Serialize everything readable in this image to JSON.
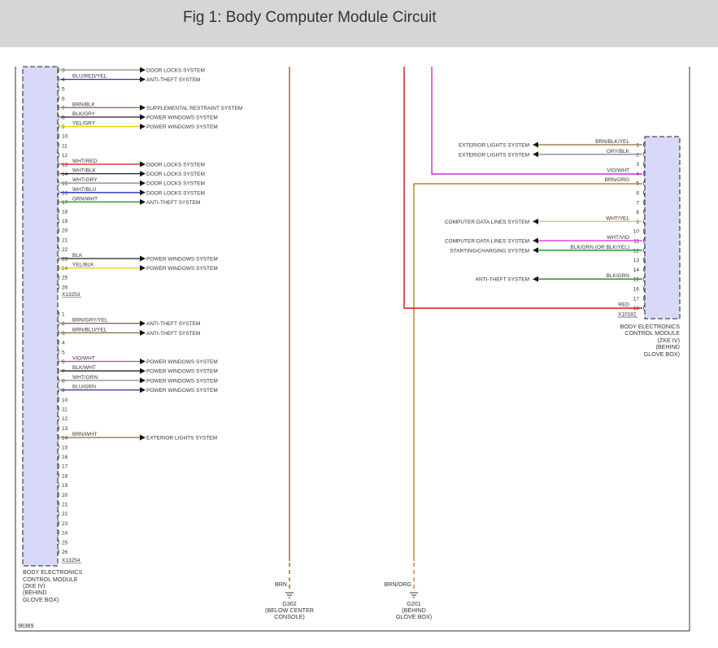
{
  "header": {
    "title": "Fig 1: Body Computer Module Circuit"
  },
  "colors": {
    "module_fill": "#d8d8f8",
    "WHT": "#d0d0d0",
    "BLU": "#2a2ab8",
    "BRN": "#8b6a2b",
    "GRY": "#8a8a8a",
    "YEL": "#e0d000",
    "RED": "#e01010",
    "GRN": "#1a8a1a",
    "BLK": "#202020",
    "VIO": "#e020e0",
    "ORG": "#b8862a"
  },
  "connector_a": {
    "label": "X13253",
    "first_pin": 3,
    "last_pin": 26,
    "wires": [
      {
        "pin": 3,
        "color": "",
        "system": "DOOR LOCKS SYSTEM",
        "stroke": "GRY"
      },
      {
        "pin": 4,
        "color": "BLU/RED/YEL",
        "system": "ANTI-THEFT SYSTEM",
        "stroke": "BLU"
      },
      {
        "pin": 7,
        "color": "BRN/BLK",
        "system": "SUPPLEMENTAL RESTRAINT SYSTEM",
        "stroke": "BRN"
      },
      {
        "pin": 8,
        "color": "BLK/GRY",
        "system": "POWER WINDOWS SYSTEM",
        "stroke": "BLK"
      },
      {
        "pin": 9,
        "color": "YEL/GRY",
        "system": "POWER WINDOWS SYSTEM",
        "stroke": "YEL"
      },
      {
        "pin": 13,
        "color": "WHT/RED",
        "system": "DOOR LOCKS SYSTEM",
        "stroke": "RED"
      },
      {
        "pin": 14,
        "color": "WHT/BLK",
        "system": "DOOR LOCKS SYSTEM",
        "stroke": "BLK"
      },
      {
        "pin": 15,
        "color": "WHT/GRY",
        "system": "DOOR LOCKS SYSTEM",
        "stroke": "GRY"
      },
      {
        "pin": 16,
        "color": "WHT/BLU",
        "system": "DOOR LOCKS SYSTEM",
        "stroke": "BLU"
      },
      {
        "pin": 17,
        "color": "GRN/WHT",
        "system": "ANTI-THEFT SYSTEM",
        "stroke": "GRN"
      },
      {
        "pin": 23,
        "color": "BLK",
        "system": "POWER WINDOWS SYSTEM",
        "stroke": "BLK"
      },
      {
        "pin": 24,
        "color": "YEL/BLK",
        "system": "POWER WINDOWS SYSTEM",
        "stroke": "YEL"
      }
    ]
  },
  "connector_b": {
    "label": "X13254",
    "first_pin": 1,
    "last_pin": 26,
    "wires": [
      {
        "pin": 2,
        "color": "BRN/GRY/YEL",
        "system": "ANTI-THEFT SYSTEM",
        "stroke": "BRN"
      },
      {
        "pin": 3,
        "color": "BRN/BLU/YEL",
        "system": "ANTI-THEFT SYSTEM",
        "stroke": "BRN"
      },
      {
        "pin": 6,
        "color": "VIO/WHT",
        "system": "POWER WINDOWS SYSTEM",
        "stroke": "VIO"
      },
      {
        "pin": 7,
        "color": "BLK/WHT",
        "system": "POWER WINDOWS SYSTEM",
        "stroke": "BLK"
      },
      {
        "pin": 8,
        "color": "WHT/GRN",
        "system": "POWER WINDOWS SYSTEM",
        "stroke": "GRY"
      },
      {
        "pin": 9,
        "color": "BLU/GRN",
        "system": "POWER WINDOWS SYSTEM",
        "stroke": "BLU"
      },
      {
        "pin": 14,
        "color": "BRN/WHT",
        "system": "EXTERIOR LIGHTS SYSTEM",
        "stroke": "BRN"
      }
    ]
  },
  "connector_c": {
    "label": "X10182",
    "first_pin": 1,
    "last_pin": 18,
    "wires": [
      {
        "pin": 1,
        "color": "BRN/BLK/YEL",
        "system": "EXTERIOR LIGHTS SYSTEM",
        "stroke": "BRN"
      },
      {
        "pin": 2,
        "color": "GRY/BLK",
        "system": "EXTERIOR LIGHTS SYSTEM",
        "stroke": "GRY"
      },
      {
        "pin": 4,
        "color": "VIO/WHT",
        "system": "",
        "stroke": "VIO"
      },
      {
        "pin": 5,
        "color": "BRN/ORG",
        "system": "",
        "stroke": "ORG"
      },
      {
        "pin": 9,
        "color": "WHT/YEL",
        "system": "COMPUTER DATA LINES SYSTEM",
        "stroke": "YEL"
      },
      {
        "pin": 11,
        "color": "WHT/VIO",
        "system": "COMPUTER DATA LINES SYSTEM",
        "stroke": "VIO"
      },
      {
        "pin": 12,
        "color": "BLK/GRN (OR BLK/YEL)",
        "system": "STARTING/CHARGING SYSTEM",
        "stroke": "GRN"
      },
      {
        "pin": 15,
        "color": "BLK/GRN",
        "system": "ANTI-THEFT SYSTEM",
        "stroke": "GRN"
      },
      {
        "pin": 18,
        "color": "RED",
        "system": "",
        "stroke": "RED"
      }
    ]
  },
  "module_left": {
    "lines": [
      "BODY ELECTRONICS",
      "CONTROL MODULE",
      "(ZKE IV)",
      "(BEHIND",
      "GLOVE BOX)"
    ]
  },
  "module_right": {
    "lines": [
      "BODY ELECTRONICS",
      "CONTROL MODULE",
      "(ZKE IV)",
      "(BEHIND",
      "GLOVE BOX)"
    ]
  },
  "ground_g302": {
    "wire": "BRN",
    "lines": [
      "G302",
      "(BELOW CENTER",
      "CONSOLE)"
    ]
  },
  "ground_g201": {
    "wire": "BRN/ORG",
    "lines": [
      "G201",
      "(BEHIND",
      "GLOVE BOX)"
    ]
  },
  "figure_id": "96389"
}
